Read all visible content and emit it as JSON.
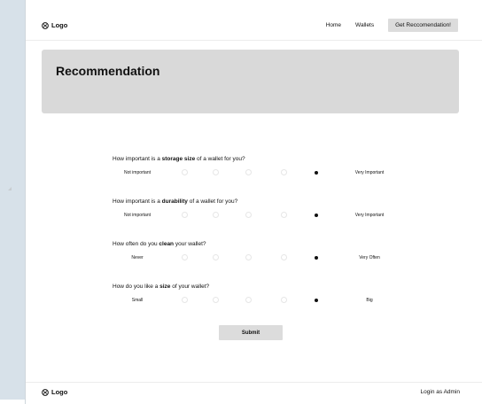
{
  "header": {
    "logo": "Logo",
    "nav": {
      "home": "Home",
      "wallets": "Wallets",
      "cta": "Get Reccomendation!"
    }
  },
  "hero": {
    "title": "Recommendation"
  },
  "questions": [
    {
      "pre": "How important is a ",
      "bold": "storage size",
      "post": " of a wallet for you?",
      "low": "Not important",
      "high": "Very Important",
      "selected": 4
    },
    {
      "pre": "How important is a ",
      "bold": "durability",
      "post": " of a wallet for you?",
      "low": "Not important",
      "high": "Very Important",
      "selected": 4
    },
    {
      "pre": "How often do you ",
      "bold": "clean",
      "post": " your wallet?",
      "low": "Never",
      "high": "Very Often",
      "selected": 4
    },
    {
      "pre": "How do you like a ",
      "bold": "size",
      "post": " of your wallet?",
      "low": "Small",
      "high": "Big",
      "selected": 4
    }
  ],
  "submit_label": "Submit",
  "footer": {
    "logo": "Logo",
    "admin": "Login as Admin"
  }
}
